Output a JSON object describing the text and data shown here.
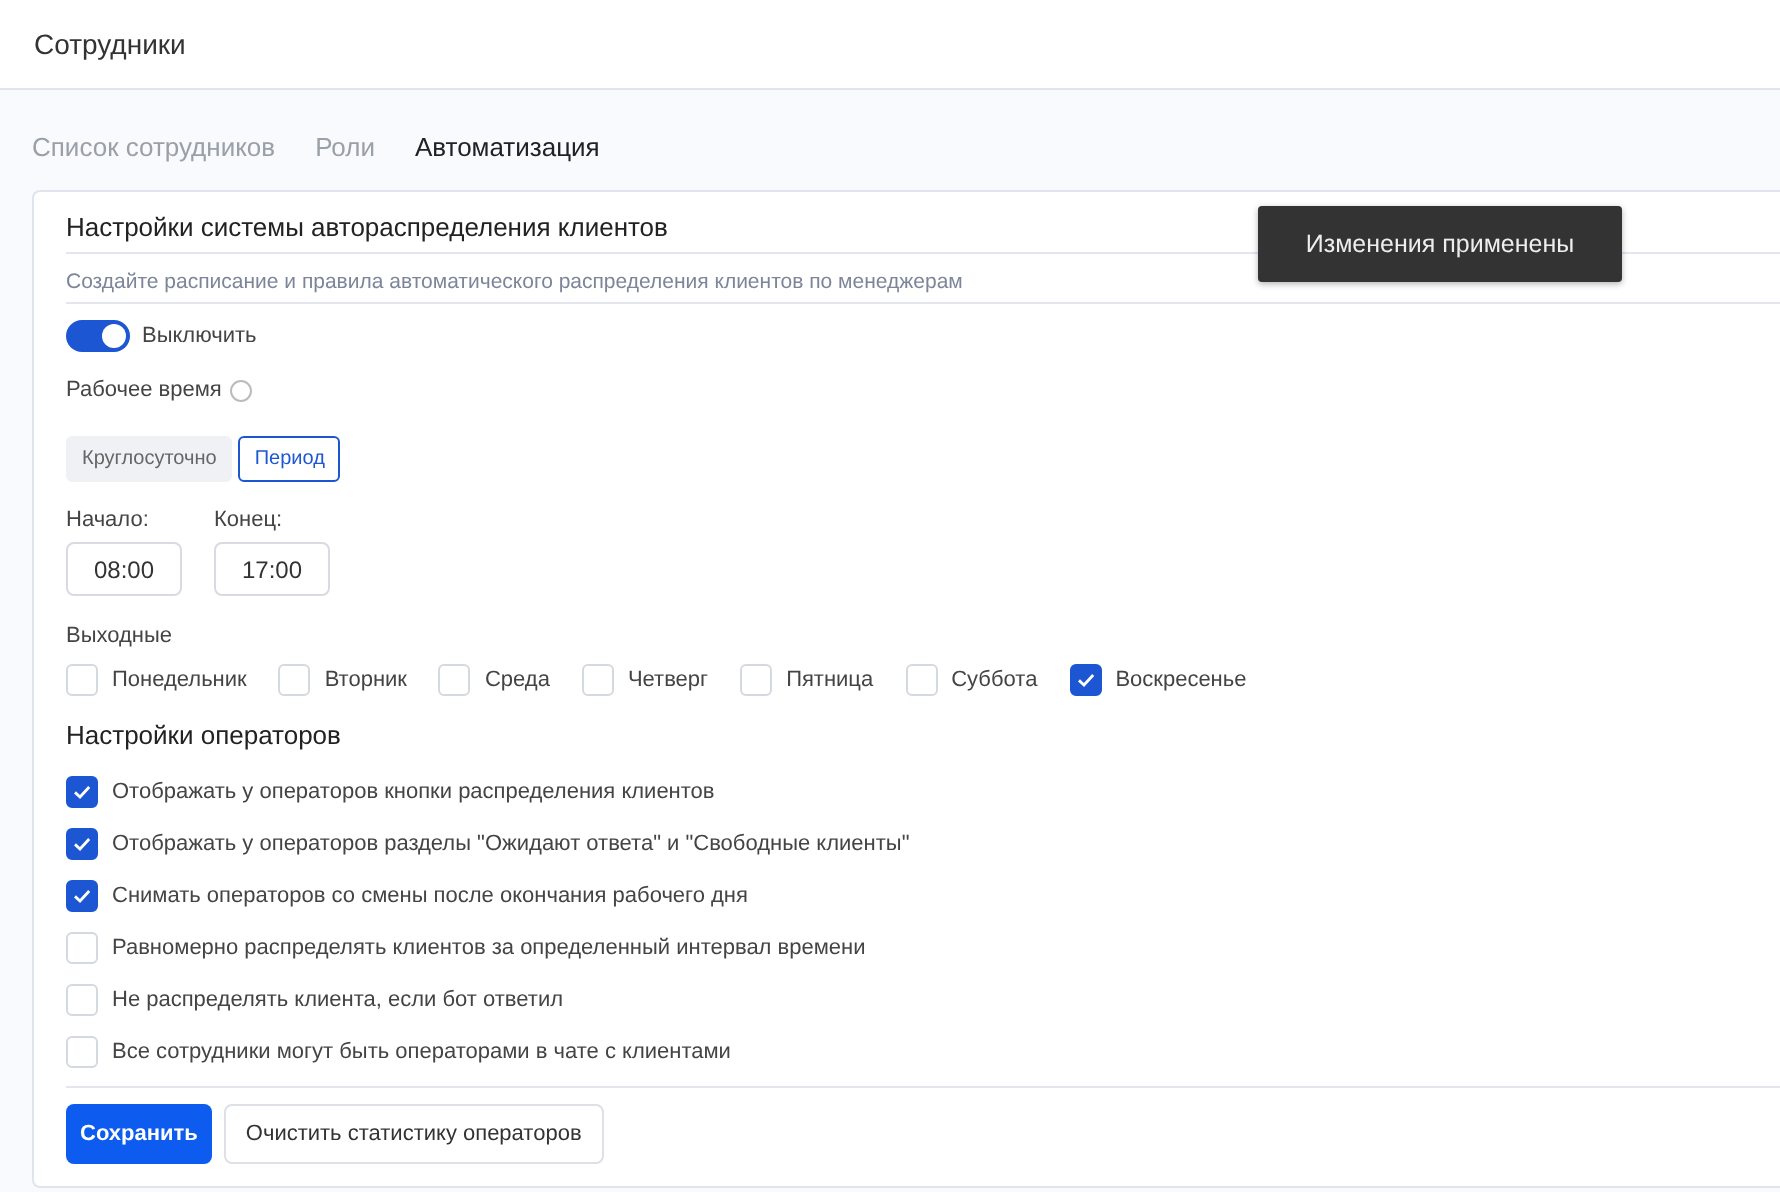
{
  "header": {
    "title": "Сотрудники"
  },
  "tabs": [
    {
      "label": "Список сотрудников",
      "selected": false
    },
    {
      "label": "Роли",
      "selected": false
    },
    {
      "label": "Автоматизация",
      "selected": true
    }
  ],
  "settings": {
    "title": "Настройки системы автораспределения клиентов",
    "subtitle": "Создайте расписание и правила автоматического распределения клиентов по менеджерам",
    "toggle": {
      "label": "Выключить",
      "on": true
    },
    "working_time": {
      "label": "Рабочее время",
      "modes": [
        {
          "label": "Круглосуточно",
          "selected": false
        },
        {
          "label": "Период",
          "selected": true
        }
      ]
    },
    "start": {
      "label": "Начало:",
      "value": "08:00"
    },
    "end": {
      "label": "Конец:",
      "value": "17:00"
    },
    "weekends": {
      "label": "Выходные",
      "days": [
        {
          "label": "Понедельник",
          "checked": false
        },
        {
          "label": "Вторник",
          "checked": false
        },
        {
          "label": "Среда",
          "checked": false
        },
        {
          "label": "Четверг",
          "checked": false
        },
        {
          "label": "Пятница",
          "checked": false
        },
        {
          "label": "Суббота",
          "checked": false
        },
        {
          "label": "Воскресенье",
          "checked": true
        }
      ]
    },
    "operators": {
      "title": "Настройки операторов",
      "options": [
        {
          "label": "Отображать у операторов кнопки распределения клиентов",
          "checked": true
        },
        {
          "label": "Отображать у операторов разделы \"Ожидают ответа\" и \"Свободные клиенты\"",
          "checked": true
        },
        {
          "label": "Снимать операторов со смены после окончания рабочего дня",
          "checked": true
        },
        {
          "label": "Равномерно распределять клиентов за определенный интервал времени",
          "checked": false
        },
        {
          "label": "Не распределять клиента, если бот ответил",
          "checked": false
        },
        {
          "label": "Все сотрудники могут быть операторами в чате с клиентами",
          "checked": false
        }
      ]
    },
    "buttons": {
      "save": "Сохранить",
      "clear": "Очистить статистику операторов"
    }
  },
  "toast": {
    "message": "Изменения применены"
  }
}
